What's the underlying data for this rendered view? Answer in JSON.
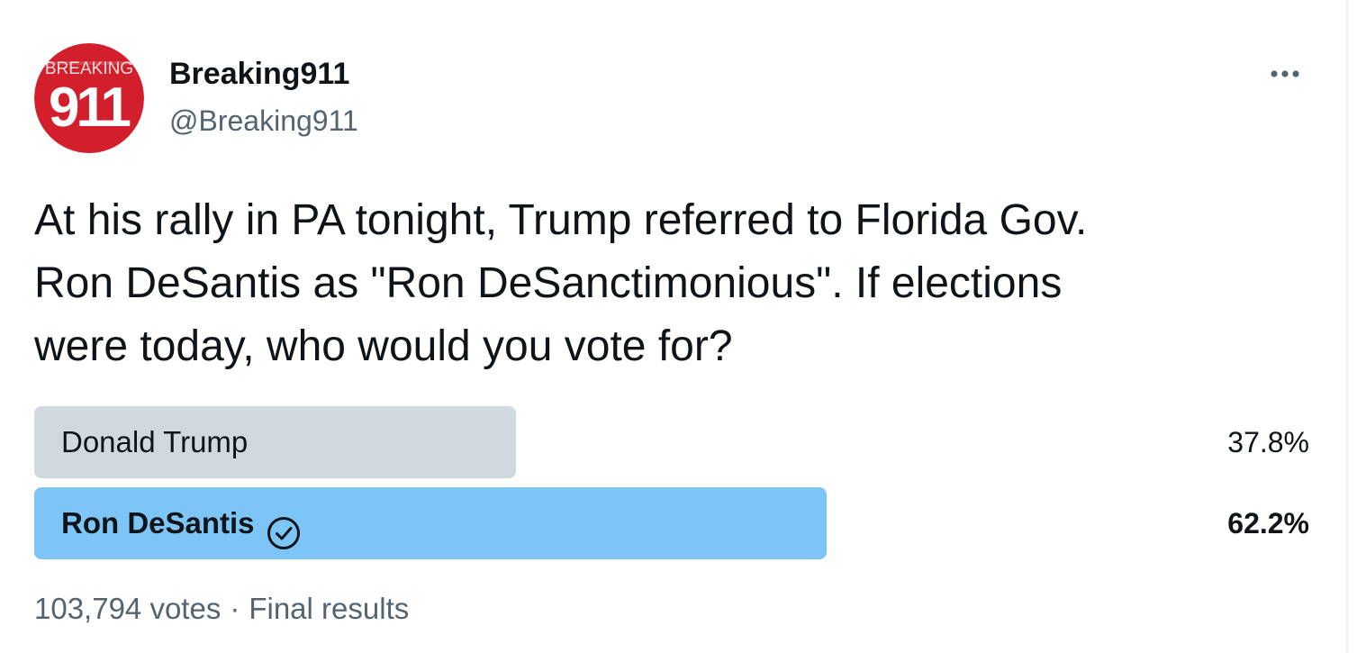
{
  "tweet": {
    "author": {
      "display_name": "Breaking911",
      "handle": "@Breaking911",
      "avatar": {
        "top_text": "BREAKING",
        "number_text": "911",
        "background_color": "#d21f2b",
        "text_color": "#ffffff"
      }
    },
    "more_icon": "more-horizontal-icon",
    "text": "At his rally in PA tonight, Trump referred to Florida Gov.\nRon DeSantis as \"Ron DeSanctimonious\". If elections\nwere today, who would you vote for?"
  },
  "poll": {
    "options": [
      {
        "label": "Donald Trump",
        "percent_text": "37.8%",
        "percent_value": 37.8,
        "winner": false,
        "bar_color": "#cfd9de"
      },
      {
        "label": "Ron DeSantis",
        "percent_text": "62.2%",
        "percent_value": 62.2,
        "winner": true,
        "bar_color": "#7dc5f6",
        "winner_icon": "check-circle-icon"
      }
    ],
    "votes_text": "103,794 votes",
    "separator": "·",
    "status_text": "Final results"
  }
}
